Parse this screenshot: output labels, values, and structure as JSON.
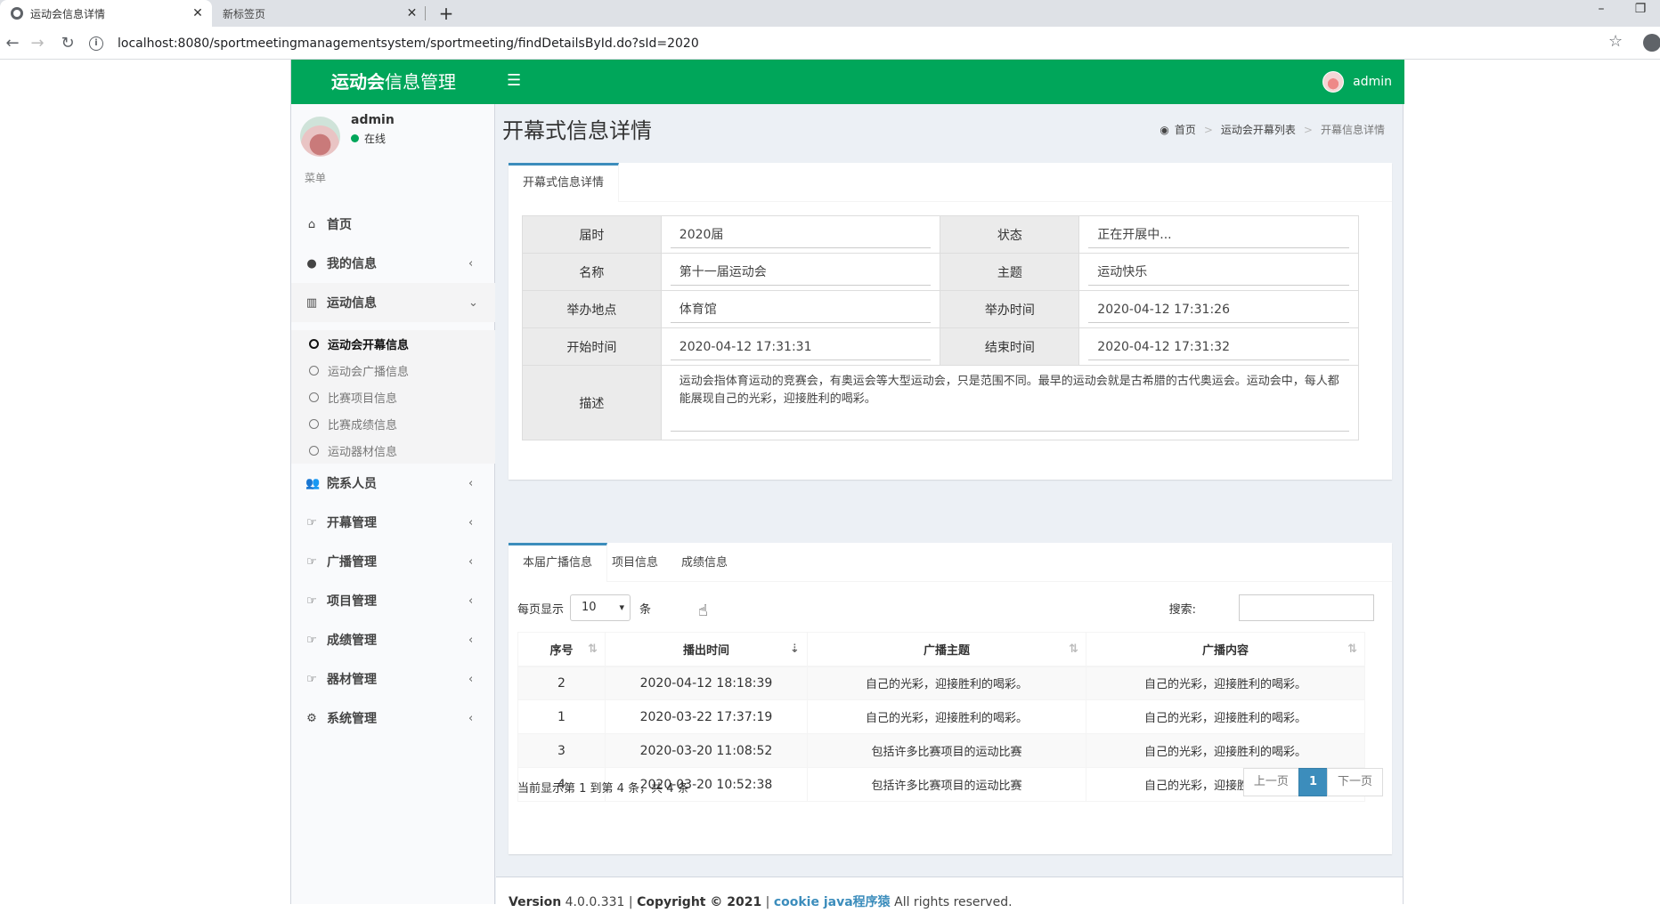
{
  "browser": {
    "tabs": [
      {
        "label": "运动会信息详情",
        "active": true
      },
      {
        "label": "新标签页",
        "active": false
      }
    ],
    "new_tab": "+",
    "url": "localhost:8080/sportmeetingmanagementsystem/sportmeeting/findDetailsById.do?sId=2020",
    "win_min": "–",
    "win_restore": "❐"
  },
  "header": {
    "logo_bold": "运动会",
    "logo_rest": "信息管理",
    "user": "admin",
    "accent": "#00a65a"
  },
  "sidebar": {
    "user_name": "admin",
    "user_status": "在线",
    "menu_header": "菜单",
    "items": [
      {
        "icon": "home-icon",
        "label": "首页",
        "arrow": ""
      },
      {
        "icon": "user-icon",
        "label": "我的信息",
        "arrow": "‹"
      },
      {
        "icon": "bar-chart-icon",
        "label": "运动信息",
        "arrow": "⌄"
      },
      {
        "icon": "users-icon",
        "label": "院系人员",
        "arrow": "‹"
      },
      {
        "icon": "hand-point-icon",
        "label": "开幕管理",
        "arrow": "‹"
      },
      {
        "icon": "hand-point-icon",
        "label": "广播管理",
        "arrow": "‹"
      },
      {
        "icon": "hand-point-icon",
        "label": "项目管理",
        "arrow": "‹"
      },
      {
        "icon": "hand-point-icon",
        "label": "成绩管理",
        "arrow": "‹"
      },
      {
        "icon": "hand-point-icon",
        "label": "器材管理",
        "arrow": "‹"
      },
      {
        "icon": "gear-icon",
        "label": "系统管理",
        "arrow": "‹"
      }
    ],
    "submenu": [
      {
        "label": "运动会开幕信息",
        "active": true
      },
      {
        "label": "运动会广播信息",
        "active": false
      },
      {
        "label": "比赛项目信息",
        "active": false
      },
      {
        "label": "比赛成绩信息",
        "active": false
      },
      {
        "label": "运动器材信息",
        "active": false
      }
    ]
  },
  "page": {
    "title": "开幕式信息详情",
    "breadcrumb": [
      "首页",
      "运动会开幕列表",
      "开幕信息详情"
    ]
  },
  "detail": {
    "tab": "开幕式信息详情",
    "rows": [
      {
        "l1": "届时",
        "v1": "2020届",
        "l2": "状态",
        "v2": "正在开展中..."
      },
      {
        "l1": "名称",
        "v1": "第十一届运动会",
        "l2": "主题",
        "v2": "运动快乐"
      },
      {
        "l1": "举办地点",
        "v1": "体育馆",
        "l2": "举办时间",
        "v2": "2020-04-12 17:31:26"
      },
      {
        "l1": "开始时间",
        "v1": "2020-04-12 17:31:31",
        "l2": "结束时间",
        "v2": "2020-04-12 17:31:32"
      }
    ],
    "desc_label": "描述",
    "desc_value": "运动会指体育运动的竞赛会，有奥运会等大型运动会，只是范围不同。最早的运动会就是古希腊的古代奥运会。运动会中，每人都能展现自己的光彩，迎接胜利的喝彩。"
  },
  "records": {
    "tabs": [
      "本届广播信息",
      "项目信息",
      "成绩信息"
    ],
    "length_prefix": "每页显示",
    "length_value": "10",
    "length_suffix": "条",
    "search_label": "搜索:",
    "columns": [
      "序号",
      "播出时间",
      "广播主题",
      "广播内容"
    ],
    "rows": [
      {
        "id": "2",
        "time": "2020-04-12 18:18:39",
        "topic": "自己的光彩，迎接胜利的喝彩。",
        "content": "自己的光彩，迎接胜利的喝彩。"
      },
      {
        "id": "1",
        "time": "2020-03-22 17:37:19",
        "topic": "自己的光彩，迎接胜利的喝彩。",
        "content": "自己的光彩，迎接胜利的喝彩。"
      },
      {
        "id": "3",
        "time": "2020-03-20 11:08:52",
        "topic": "包括许多比赛项目的运动比赛",
        "content": "自己的光彩，迎接胜利的喝彩。"
      },
      {
        "id": "4",
        "time": "2020-03-20 10:52:38",
        "topic": "包括许多比赛项目的运动比赛",
        "content": "自己的光彩，迎接胜利的喝彩。"
      }
    ],
    "info": "当前显示第 1 到第 4 条，共 4 条",
    "prev": "上一页",
    "current_page": "1",
    "next": "下一页"
  },
  "footer": {
    "version_label": "Version",
    "version": "4.0.0.331",
    "copyright": "Copyright © 2021",
    "link": "cookie java程序猿",
    "rights": "All rights reserved."
  }
}
